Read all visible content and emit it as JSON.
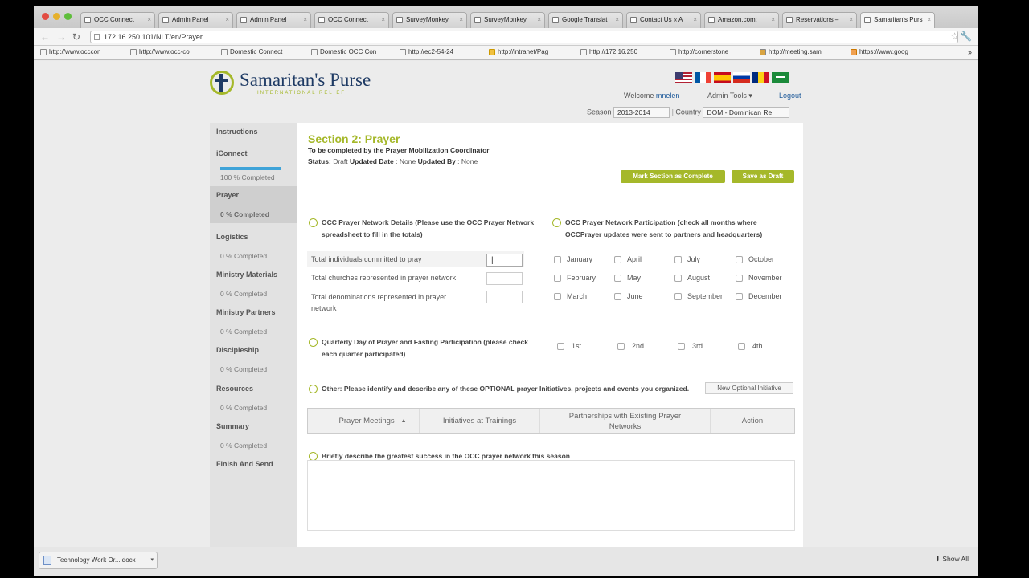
{
  "browser": {
    "tabs": [
      {
        "label": "OCC Connect"
      },
      {
        "label": "Admin Panel"
      },
      {
        "label": "Admin Panel"
      },
      {
        "label": "OCC Connect"
      },
      {
        "label": "SurveyMonkey"
      },
      {
        "label": "SurveyMonkey"
      },
      {
        "label": "Google Translat"
      },
      {
        "label": "Contact Us « A"
      },
      {
        "label": "Amazon.com: "
      },
      {
        "label": "Reservations –"
      },
      {
        "label": "Samaritan's Purs"
      }
    ],
    "url": "172.16.250.101/NLT/en/Prayer",
    "bookmarks": [
      "http://www.occcon",
      "http://www.occ-co",
      "Domestic Connect",
      "Domestic OCC Con",
      "http://ec2-54-24",
      "http://intranet/Pag",
      "http://172.16.250",
      "http://cornerstone",
      "http://meeting.sam",
      "https://www.goog"
    ]
  },
  "header": {
    "logo_name": "Samaritan's Purse",
    "logo_sub": "INTERNATIONAL RELIEF",
    "welcome_label": "Welcome",
    "username": "mnelen",
    "admin_tools": "Admin Tools",
    "logout": "Logout",
    "season_label": "Season",
    "season_value": "2013-2014",
    "country_label": "Country",
    "country_value": "DOM - Dominican Re"
  },
  "sidebar": {
    "items": [
      {
        "title": "Instructions",
        "progress": ""
      },
      {
        "title": "iConnect",
        "progress": "100 % Completed",
        "fraction": 1.0
      },
      {
        "title": "Prayer",
        "progress": "0 % Completed"
      },
      {
        "title": "Logistics",
        "progress": "0 % Completed"
      },
      {
        "title": "Ministry Materials",
        "progress": "0 % Completed"
      },
      {
        "title": "Ministry Partners",
        "progress": "0 % Completed"
      },
      {
        "title": "Discipleship",
        "progress": "0 % Completed"
      },
      {
        "title": "Resources",
        "progress": "0 % Completed"
      },
      {
        "title": "Summary",
        "progress": "0 % Completed"
      },
      {
        "title": "Finish And Send",
        "progress": ""
      }
    ]
  },
  "section": {
    "title": "Section 2: Prayer",
    "subtitle": "To be completed by the Prayer Mobilization Coordinator",
    "status_label": "Status:",
    "status_value": "Draft",
    "updated_date_label": "Updated Date",
    "updated_date_value": "None",
    "updated_by_label": "Updated By",
    "updated_by_value": "None",
    "mark_complete": "Mark Section as Complete",
    "save_draft": "Save as Draft"
  },
  "network": {
    "heading": "OCC Prayer Network Details (Please use the OCC Prayer Network spreadsheet to fill in the totals)",
    "fields": [
      "Total individuals committed to pray",
      "Total churches represented in prayer network",
      "Total denominations represented in prayer network"
    ]
  },
  "participation": {
    "heading": "OCC Prayer Network Participation (check all months where OCCPrayer updates were sent to partners and headquarters)",
    "months": [
      "January",
      "April",
      "July",
      "October",
      "February",
      "May",
      "August",
      "November",
      "March",
      "June",
      "September",
      "December"
    ]
  },
  "quarterly": {
    "heading": "Quarterly Day of Prayer and Fasting Participation (please check each quarter participated)",
    "quarters": [
      "1st",
      "2nd",
      "3rd",
      "4th"
    ]
  },
  "other": {
    "heading": "Other: Please identify and describe any of these OPTIONAL prayer Initiatives, projects and events you organized.",
    "new_button": "New Optional Initiative",
    "columns": [
      "Prayer Meetings",
      "Initiatives at Trainings",
      "Partnerships with Existing Prayer Networks",
      "Action"
    ],
    "sort_indicator": "▲"
  },
  "success": {
    "heading": "Briefly describe the greatest success in the OCC prayer network this season"
  },
  "downloads": {
    "file": "Technology Work Or....docx",
    "show_all": "Show All"
  }
}
